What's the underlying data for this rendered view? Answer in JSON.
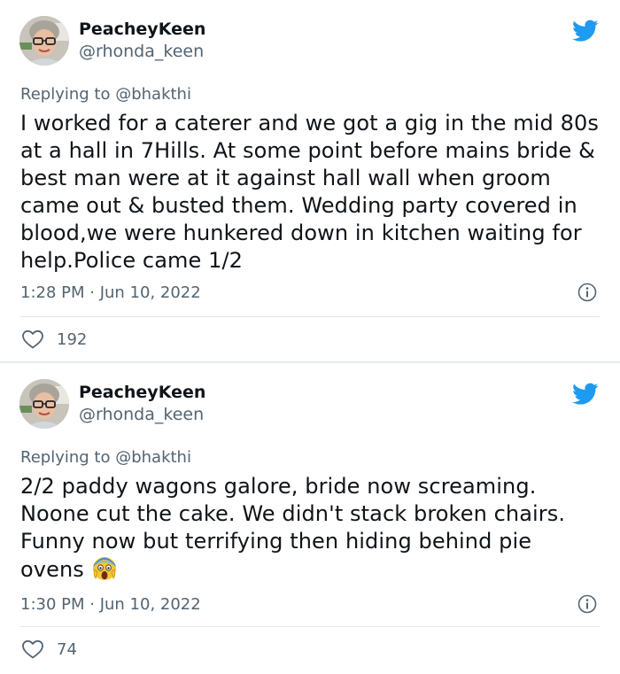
{
  "tweets": [
    {
      "display_name": "PeacheyKeen",
      "handle": "@rhonda_keen",
      "replying_label": "Replying to ",
      "replying_to": "@bhakthi",
      "text": "I worked for a caterer and we got a gig in the mid 80s at a hall in 7Hills. At some point before mains bride & best man were at it against hall wall when groom came out & busted them. Wedding party covered in blood,we were hunkered down in kitchen waiting for help.Police came 1/2",
      "timestamp": "1:28 PM · Jun 10, 2022",
      "likes": "192"
    },
    {
      "display_name": "PeacheyKeen",
      "handle": "@rhonda_keen",
      "replying_label": "Replying to ",
      "replying_to": "@bhakthi",
      "text": "2/2 paddy wagons galore, bride now screaming. Noone cut the cake. We didn't stack broken chairs. Funny now but terrifying then hiding behind pie ovens ",
      "emoji": "screaming-face-emoji",
      "timestamp": "1:30 PM · Jun 10, 2022",
      "likes": "74"
    }
  ],
  "colors": {
    "twitter_blue": "#1d9bf0",
    "text": "#0f1419",
    "secondary": "#536471",
    "separator": "#e6ecf0"
  },
  "icons": [
    "twitter-bird-icon",
    "info-icon",
    "heart-icon"
  ]
}
